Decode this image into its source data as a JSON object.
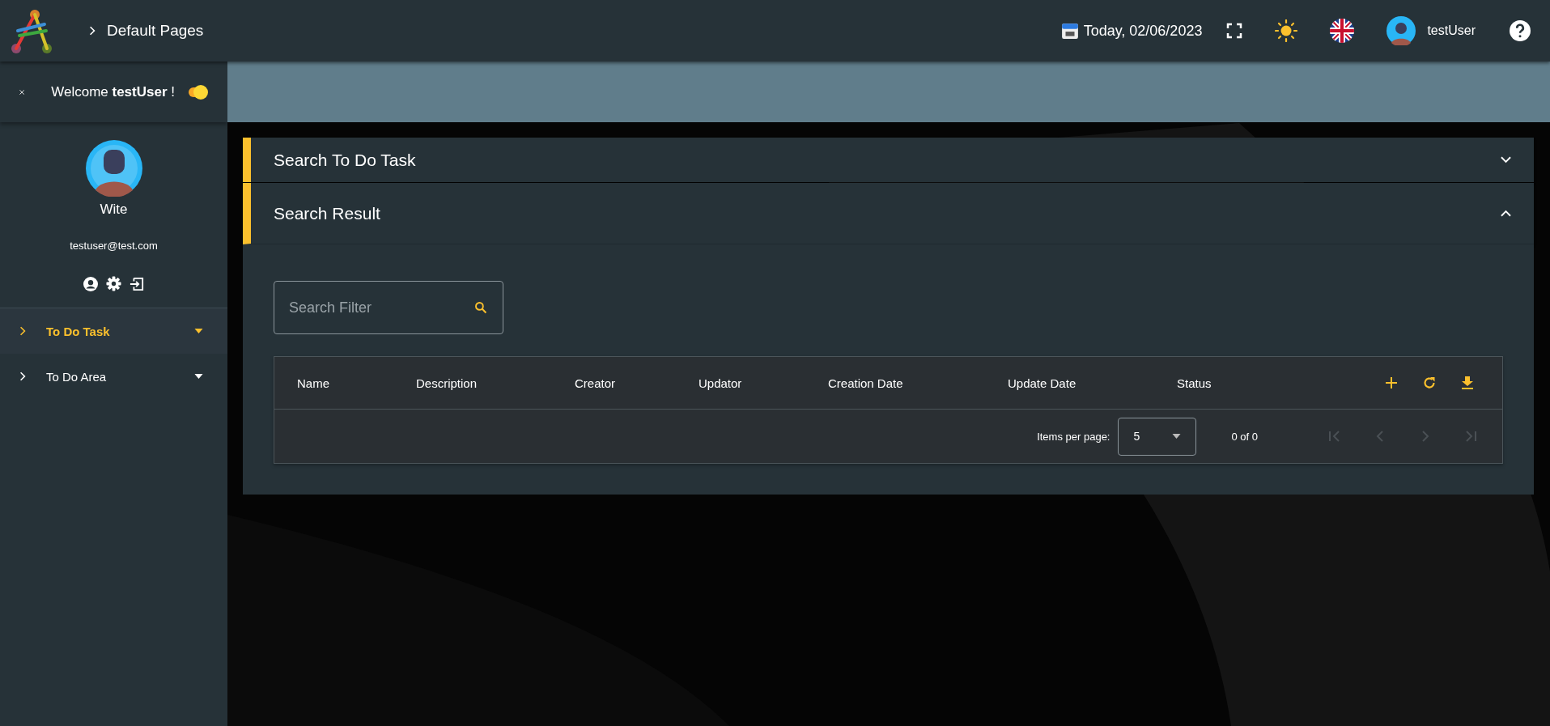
{
  "header": {
    "breadcrumb": "Default Pages",
    "date": "Today, 02/06/2023",
    "user": "testUser"
  },
  "sidebar": {
    "welcome": "Welcome **testUser** !",
    "theme_toggle": {
      "on": true
    },
    "profile": {
      "name": "Wite",
      "email": "testuser@test.com"
    },
    "items": [
      {
        "label": "To Do Task",
        "selected": true
      },
      {
        "label": "To Do Area",
        "selected": false
      }
    ]
  },
  "panels": [
    {
      "title": "Search To Do Task",
      "expanded": false
    },
    {
      "title": "Search Result",
      "expanded": true
    }
  ],
  "search": {
    "placeholder": "Search Filter"
  },
  "table": {
    "columns": [
      "Name",
      "Description",
      "Creator",
      "Updator",
      "Creation Date",
      "Update Date",
      "Status"
    ]
  },
  "paginator": {
    "label": "Items per page:",
    "page_size": "5",
    "range": "0 of 0",
    "buttons": [
      {
        "kind": "first",
        "disabled": true
      },
      {
        "kind": "prev",
        "disabled": true
      },
      {
        "kind": "next",
        "disabled": true
      },
      {
        "kind": "last",
        "disabled": true
      }
    ]
  }
}
